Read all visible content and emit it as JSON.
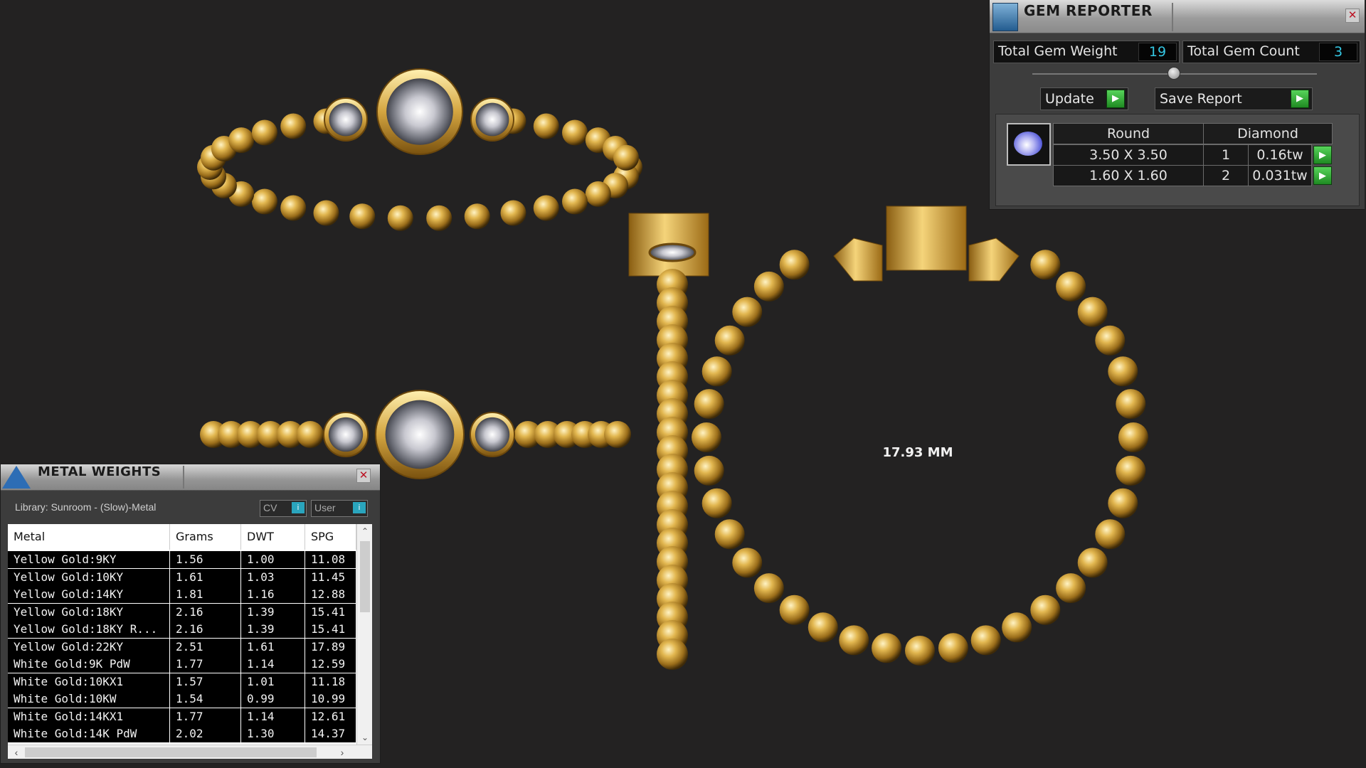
{
  "viewport": {
    "dimension_label": "17.93 MM"
  },
  "gem_reporter": {
    "title": "GEM REPORTER",
    "close_glyph": "✕",
    "total_weight_label": "Total Gem Weight",
    "total_weight_value": "19",
    "total_count_label": "Total Gem Count",
    "total_count_value": "3",
    "update_label": "Update",
    "save_report_label": "Save Report",
    "table": {
      "shape_header": "Round",
      "type_header": "Diamond",
      "rows": [
        {
          "size": "3.50 X 3.50",
          "count": "1",
          "weight": "0.16tw"
        },
        {
          "size": "1.60 X 1.60",
          "count": "2",
          "weight": "0.031tw"
        }
      ]
    },
    "icons": {
      "title": "gem-reporter-icon",
      "thumb": "round-diamond-icon",
      "arrow": "play-arrow-icon"
    }
  },
  "metal_weights": {
    "title": "METAL WEIGHTS",
    "close_glyph": "✕",
    "library": "Library: Sunroom - (Slow)-Metal",
    "cv_label": "CV",
    "user_label": "User",
    "columns": [
      "Metal",
      "Grams",
      "DWT",
      "SPG"
    ],
    "rows": [
      [
        "Yellow Gold:9KY",
        "1.56",
        "1.00",
        "11.08"
      ],
      [
        "Yellow Gold:10KY",
        "1.61",
        "1.03",
        "11.45"
      ],
      [
        "Yellow Gold:14KY",
        "1.81",
        "1.16",
        "12.88"
      ],
      [
        "Yellow Gold:18KY",
        "2.16",
        "1.39",
        "15.41"
      ],
      [
        "Yellow Gold:18KY R...",
        "2.16",
        "1.39",
        "15.41"
      ],
      [
        "Yellow Gold:22KY",
        "2.51",
        "1.61",
        "17.89"
      ],
      [
        "White Gold:9K PdW",
        "1.77",
        "1.14",
        "12.59"
      ],
      [
        "White Gold:10KX1",
        "1.57",
        "1.01",
        "11.18"
      ],
      [
        "White Gold:10KW",
        "1.54",
        "0.99",
        "10.99"
      ],
      [
        "White Gold:14KX1",
        "1.77",
        "1.14",
        "12.61"
      ],
      [
        "White Gold:14K PdW",
        "2.02",
        "1.30",
        "14.37"
      ]
    ]
  }
}
